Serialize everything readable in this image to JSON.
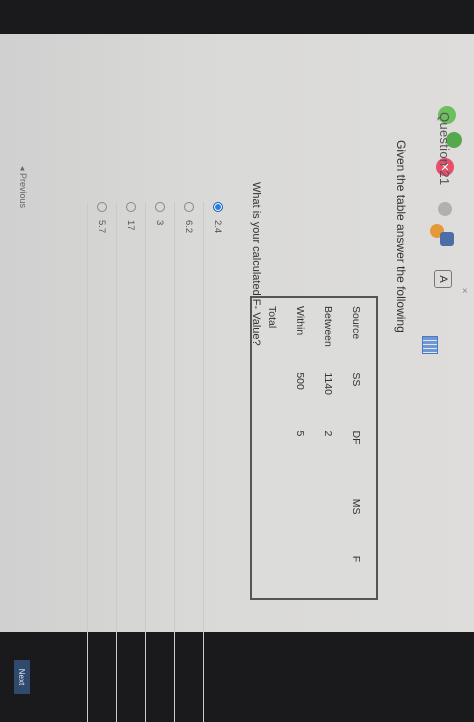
{
  "header": {
    "question_label": "Question 21"
  },
  "prompt": "Given the table answer the following",
  "anova_table": {
    "headers": [
      "Source",
      "SS",
      "DF",
      "MS",
      "F"
    ],
    "rows": [
      [
        "Between",
        "1140",
        "2",
        "",
        ""
      ],
      [
        "Within",
        "500",
        "5",
        "",
        ""
      ],
      [
        "Total",
        "",
        "",
        "",
        ""
      ]
    ]
  },
  "question": "What is your calculated F- Value?",
  "options": [
    {
      "label": "2.4",
      "selected": true
    },
    {
      "label": "6.2",
      "selected": false
    },
    {
      "label": "3",
      "selected": false
    },
    {
      "label": "17",
      "selected": false
    },
    {
      "label": "5.7",
      "selected": false
    }
  ],
  "navigation": {
    "previous_label": "◂ Previous",
    "next_label": "Next"
  },
  "extensions": {
    "red_icon_glyph": "✕",
    "text_icon_glyph": "A"
  },
  "colors": {
    "selected_radio": "#2a7de1",
    "next_button": "#2f4a6d"
  }
}
